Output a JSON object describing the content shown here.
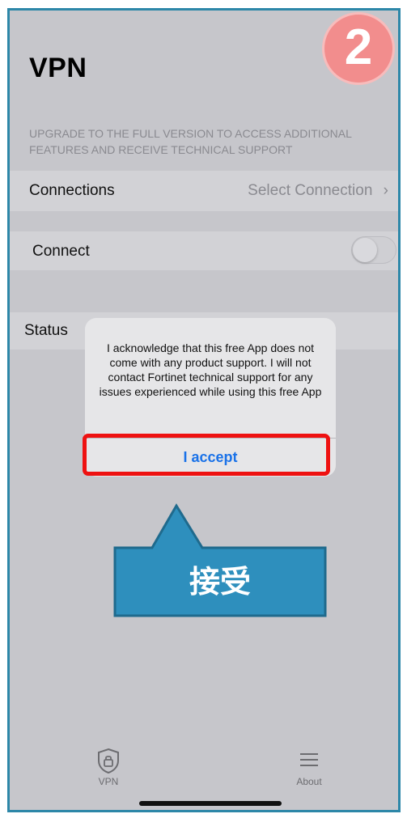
{
  "header": {
    "title": "VPN"
  },
  "notice": "UPGRADE TO THE FULL VERSION TO ACCESS ADDITIONAL FEATURES AND RECEIVE TECHNICAL SUPPORT",
  "connections": {
    "label": "Connections",
    "value": "Select Connection",
    "chevron": "›"
  },
  "connect": {
    "label": "Connect",
    "enabled": false
  },
  "status": {
    "label": "Status"
  },
  "dialog": {
    "message": "I acknowledge that this free App does not come with any product support. I will not contact Fortinet technical support for any issues experienced while using this free App",
    "button": "I accept"
  },
  "step_badge": "2",
  "callout": {
    "text": "接受",
    "color": "#2e8fbd"
  },
  "tabbar": {
    "tabs": [
      {
        "label": "VPN",
        "icon": "shield-lock-icon"
      },
      {
        "label": "About",
        "icon": "list-icon"
      }
    ]
  },
  "colors": {
    "accent": "#1a72e8",
    "highlight": "#ee1111",
    "badge": "#f28d8d",
    "frame": "#2d87a8"
  }
}
